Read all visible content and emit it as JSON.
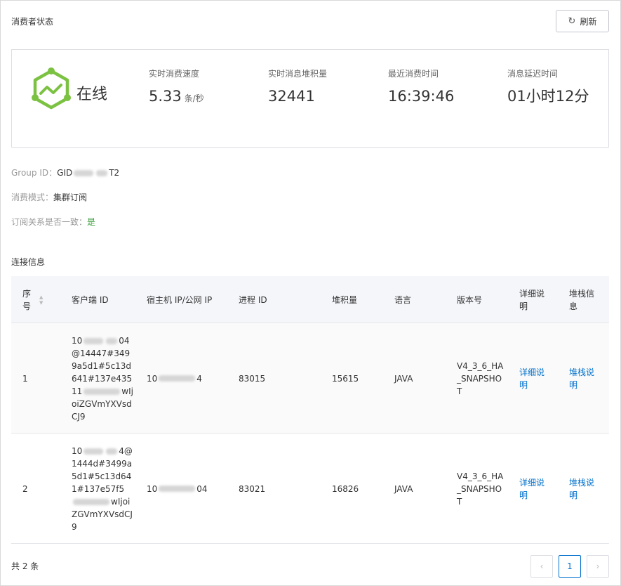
{
  "header": {
    "title": "消费者状态",
    "refresh_label": "刷新"
  },
  "status": {
    "text": "在线",
    "accent_color": "#7cc242",
    "metrics": [
      {
        "label": "实时消费速度",
        "value": "5.33",
        "unit": "条/秒"
      },
      {
        "label": "实时消息堆积量",
        "value": "32441"
      },
      {
        "label": "最近消费时间",
        "value": "16:39:46"
      },
      {
        "label": "消息延迟时间",
        "value": "01小时12分"
      }
    ]
  },
  "info": {
    "group_id_label": "Group ID：",
    "group_id_prefix": "GID",
    "group_id_suffix": "T2",
    "mode_label": "消费模式：",
    "mode_value": "集群订阅",
    "consistent_label": "订阅关系是否一致：",
    "consistent_value": "是"
  },
  "connections": {
    "title": "连接信息",
    "columns": [
      "序号",
      "客户端 ID",
      "宿主机 IP/公网 IP",
      "进程 ID",
      "堆积量",
      "语言",
      "版本号",
      "详细说明",
      "堆栈信息"
    ],
    "rows": [
      {
        "index": "1",
        "client_id_start": "10",
        "client_id_mid1": "04",
        "client_id_mid2": "@14447#3499a5d1#5c13d641#137e43511",
        "client_id_end": "wIjoiZGVmYXVsdCJ9",
        "host_prefix": "10",
        "host_suffix": "4",
        "pid": "83015",
        "accumulation": "15615",
        "language": "JAVA",
        "version": "V4_3_6_HA_SNAPSHOT",
        "detail_link": "详细说明",
        "stack_link": "堆栈说明"
      },
      {
        "index": "2",
        "client_id_start": "10",
        "client_id_mid1": "4",
        "client_id_mid2": "@1444d#3499a5d1#5c13d641#137e57f5",
        "client_id_end": "wIjoiZGVmYXVsdCJ9",
        "host_prefix": "10",
        "host_suffix": "04",
        "pid": "83021",
        "accumulation": "16826",
        "language": "JAVA",
        "version": "V4_3_6_HA_SNAPSHOT",
        "detail_link": "详细说明",
        "stack_link": "堆栈说明"
      }
    ]
  },
  "pagination": {
    "total_text": "共 2 条",
    "current_page": "1",
    "prev_icon": "chevron-left-icon",
    "next_icon": "chevron-right-icon"
  }
}
